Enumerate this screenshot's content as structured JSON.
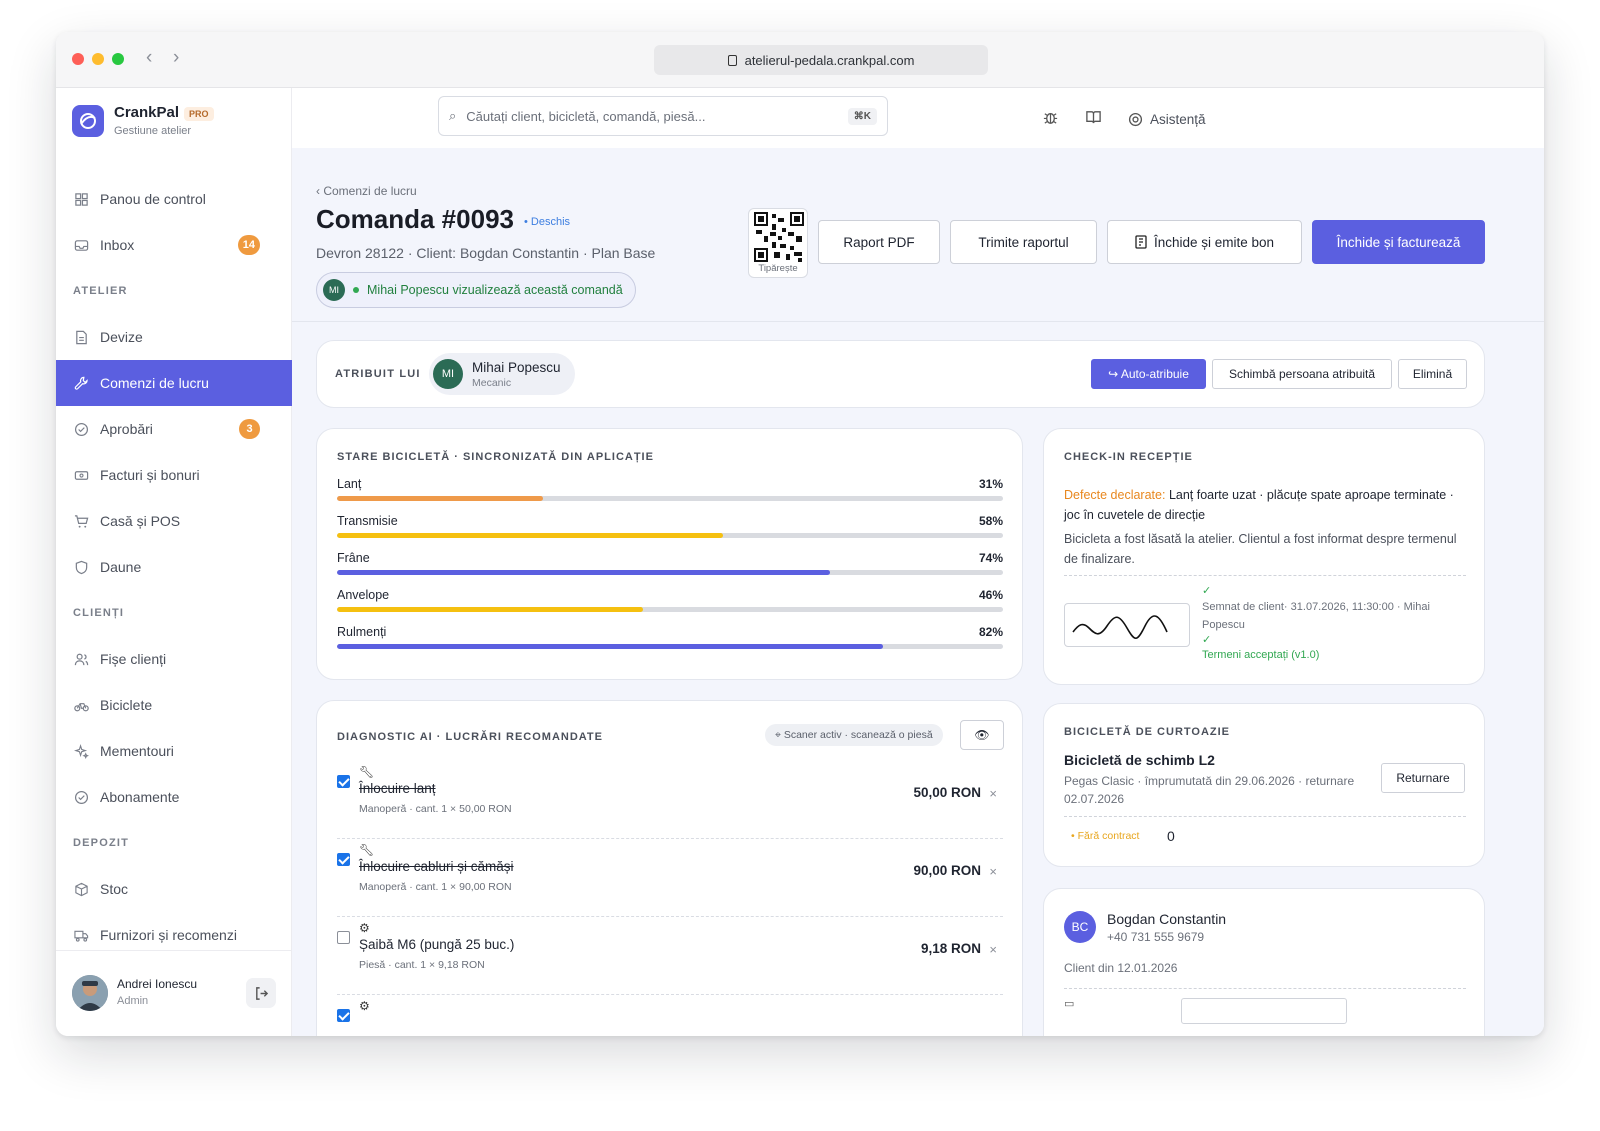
{
  "browser": {
    "url": "atelierul-pedala.crankpal.com"
  },
  "brand": {
    "name": "CrankPal",
    "tier": "PRO",
    "subtitle": "Gestiune atelier"
  },
  "search": {
    "placeholder": "Căutați client, bicicletă, comandă, piesă...",
    "shortcut": "⌘K"
  },
  "topbar": {
    "help_label": "Asistență"
  },
  "sidebar": {
    "items": [
      {
        "type": "item",
        "label": "Panou de control",
        "icon": "grid-icon"
      },
      {
        "type": "item",
        "label": "Inbox",
        "icon": "inbox-icon",
        "badge": "14"
      },
      {
        "type": "section",
        "label": "ATELIER"
      },
      {
        "type": "item",
        "label": "Devize",
        "icon": "document-icon"
      },
      {
        "type": "item",
        "label": "Comenzi de lucru",
        "icon": "wrench-icon",
        "active": true
      },
      {
        "type": "item",
        "label": "Aprobări",
        "icon": "check-circle-icon",
        "badge": "3"
      },
      {
        "type": "item",
        "label": "Facturi și bonuri",
        "icon": "receipt-icon"
      },
      {
        "type": "item",
        "label": "Casă și POS",
        "icon": "cart-icon"
      },
      {
        "type": "item",
        "label": "Daune",
        "icon": "shield-icon"
      },
      {
        "type": "section",
        "label": "CLIENȚI"
      },
      {
        "type": "item",
        "label": "Fișe clienți",
        "icon": "users-icon"
      },
      {
        "type": "item",
        "label": "Biciclete",
        "icon": "bicycle-icon"
      },
      {
        "type": "item",
        "label": "Mementouri",
        "icon": "sparkle-icon"
      },
      {
        "type": "item",
        "label": "Abonamente",
        "icon": "check-circle-icon"
      },
      {
        "type": "section",
        "label": "DEPOZIT"
      },
      {
        "type": "item",
        "label": "Stoc",
        "icon": "box-icon"
      },
      {
        "type": "item",
        "label": "Furnizori și recomenzi",
        "icon": "truck-icon"
      }
    ],
    "user": {
      "name": "Andrei Ionescu",
      "role": "Admin"
    }
  },
  "order": {
    "breadcrumb": "‹ Comenzi de lucru",
    "title": "Comanda #0093",
    "status": "• Deschis",
    "subtitle": "Devron 28122 · Client: Bogdan Constantin · Plan Base",
    "viewer_initials": "MI",
    "viewer_text": "Mihai Popescu vizualizează această comandă",
    "qr_label": "Tipărește",
    "actions": {
      "pdf": "Raport PDF",
      "send": "Trimite raportul",
      "close_receipt": "Închide și emite bon",
      "close_invoice": "Închide și facturează"
    }
  },
  "assignment": {
    "label": "ATRIBUIT LUI",
    "initials": "MI",
    "name": "Mihai Popescu",
    "role": "Mecanic",
    "auto": "↪ Auto-atribuie",
    "change": "Schimbă persoana atribuită",
    "remove": "Elimină"
  },
  "bike_state": {
    "title": "STARE BICICLETĂ · SINCRONIZATĂ DIN APLICAȚIE",
    "components": [
      {
        "label": "Lanț",
        "pct_label": "31%",
        "value": 31,
        "color": "#ef9a4a"
      },
      {
        "label": "Transmisie",
        "pct_label": "58%",
        "value": 58,
        "color": "#f5c010"
      },
      {
        "label": "Frâne",
        "pct_label": "74%",
        "value": 74,
        "color": "#5b5fe0"
      },
      {
        "label": "Anvelope",
        "pct_label": "46%",
        "value": 46,
        "color": "#f5c010"
      },
      {
        "label": "Rulmenți",
        "pct_label": "82%",
        "value": 82,
        "color": "#5b5fe0"
      }
    ]
  },
  "checkin": {
    "title": "CHECK-IN RECEPȚIE",
    "defects_label": "Defecte declarate:",
    "defects_text": "Lanț foarte uzat · plăcuțe spate aproape terminate · joc în cuvetele de direcție",
    "note": "Bicicleta a fost lăsată la atelier. Clientul a fost informat despre termenul de finalizare.",
    "signed": "Semnat de client· 31.07.2026, 11:30:00 · Mihai Popescu",
    "terms": "Termeni acceptați (v1.0)"
  },
  "diagnostic": {
    "title": "DIAGNOSTIC AI · LUCRĂRI RECOMANDATE",
    "scanner": "⌖ Scaner activ · scanează o piesă",
    "items": [
      {
        "checked": true,
        "icon": "wrench-icon",
        "name": "Înlocuire lanț",
        "strike": true,
        "meta": "Manoperă · cant. 1 × 50,00 RON",
        "price": "50,00 RON"
      },
      {
        "checked": true,
        "icon": "wrench-icon",
        "name": "Înlocuire cabluri și cămăși",
        "strike": true,
        "meta": "Manoperă · cant. 1 × 90,00 RON",
        "price": "90,00 RON"
      },
      {
        "checked": false,
        "icon": "gear-icon",
        "name": "Șaibă M6 (pungă 25 buc.)",
        "strike": false,
        "meta": "Piesă · cant. 1 × 9,18 RON",
        "price": "9,18 RON"
      },
      {
        "checked": true,
        "icon": "gear-icon",
        "name": "",
        "strike": false,
        "meta": "",
        "price": ""
      }
    ]
  },
  "courtesy": {
    "title": "BICICLETĂ DE CURTOAZIE",
    "name": "Bicicletă de schimb L2",
    "detail": "Pegas Clasic · împrumutată din 29.06.2026 · returnare 02.07.2026",
    "return_label": "Returnare",
    "contract": "• Fără contract",
    "count": "0"
  },
  "customer": {
    "initials": "BC",
    "name": "Bogdan Constantin",
    "phone": "+40 731 555 9679",
    "since": "Client din 12.01.2026"
  }
}
